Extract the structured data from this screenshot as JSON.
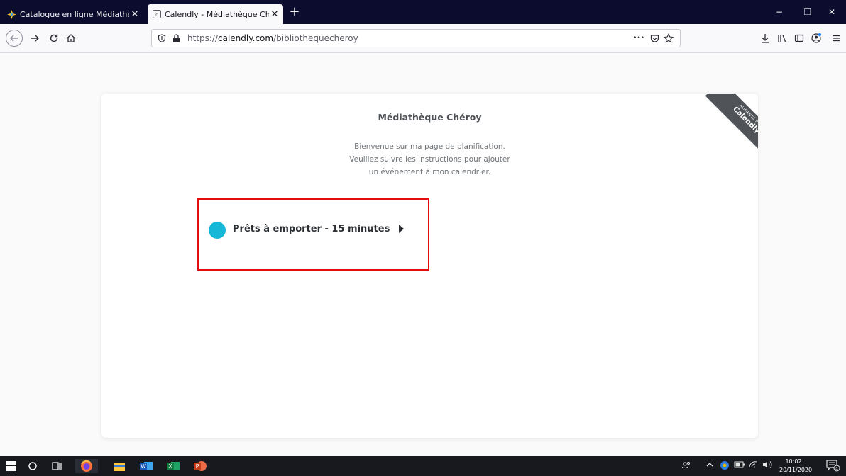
{
  "browser": {
    "tabs": [
      {
        "label": "Catalogue en ligne Médiathèqu",
        "close": "✕",
        "active": false
      },
      {
        "label": "Calendly - Médiathèque Chéro",
        "close": "✕",
        "active": true
      }
    ],
    "new_tab": "+",
    "window_controls": {
      "minimize": "−",
      "restore": "❐",
      "close": "✕"
    },
    "url": {
      "prefix": "https://",
      "host": "calendly.com",
      "path": "/bibliothequecheroy"
    },
    "url_actions": {
      "more": "•••"
    }
  },
  "page": {
    "title": "Médiathèque Chéroy",
    "welcome_lines": [
      "Bienvenue sur ma page de planification.",
      "Veuillez suivre les instructions pour ajouter",
      "un événement à mon calendrier."
    ],
    "event": {
      "name": "Prêts à emporter - 15 minutes",
      "color": "#17b8d7"
    },
    "ribbon": {
      "line1": "ALIMENTÉ PAR",
      "line2": "Calendly"
    },
    "highlight_color": "#e40d0d"
  },
  "taskbar": {
    "clock_time": "10:02",
    "clock_date": "20/11/2020",
    "notification_count": "4"
  }
}
